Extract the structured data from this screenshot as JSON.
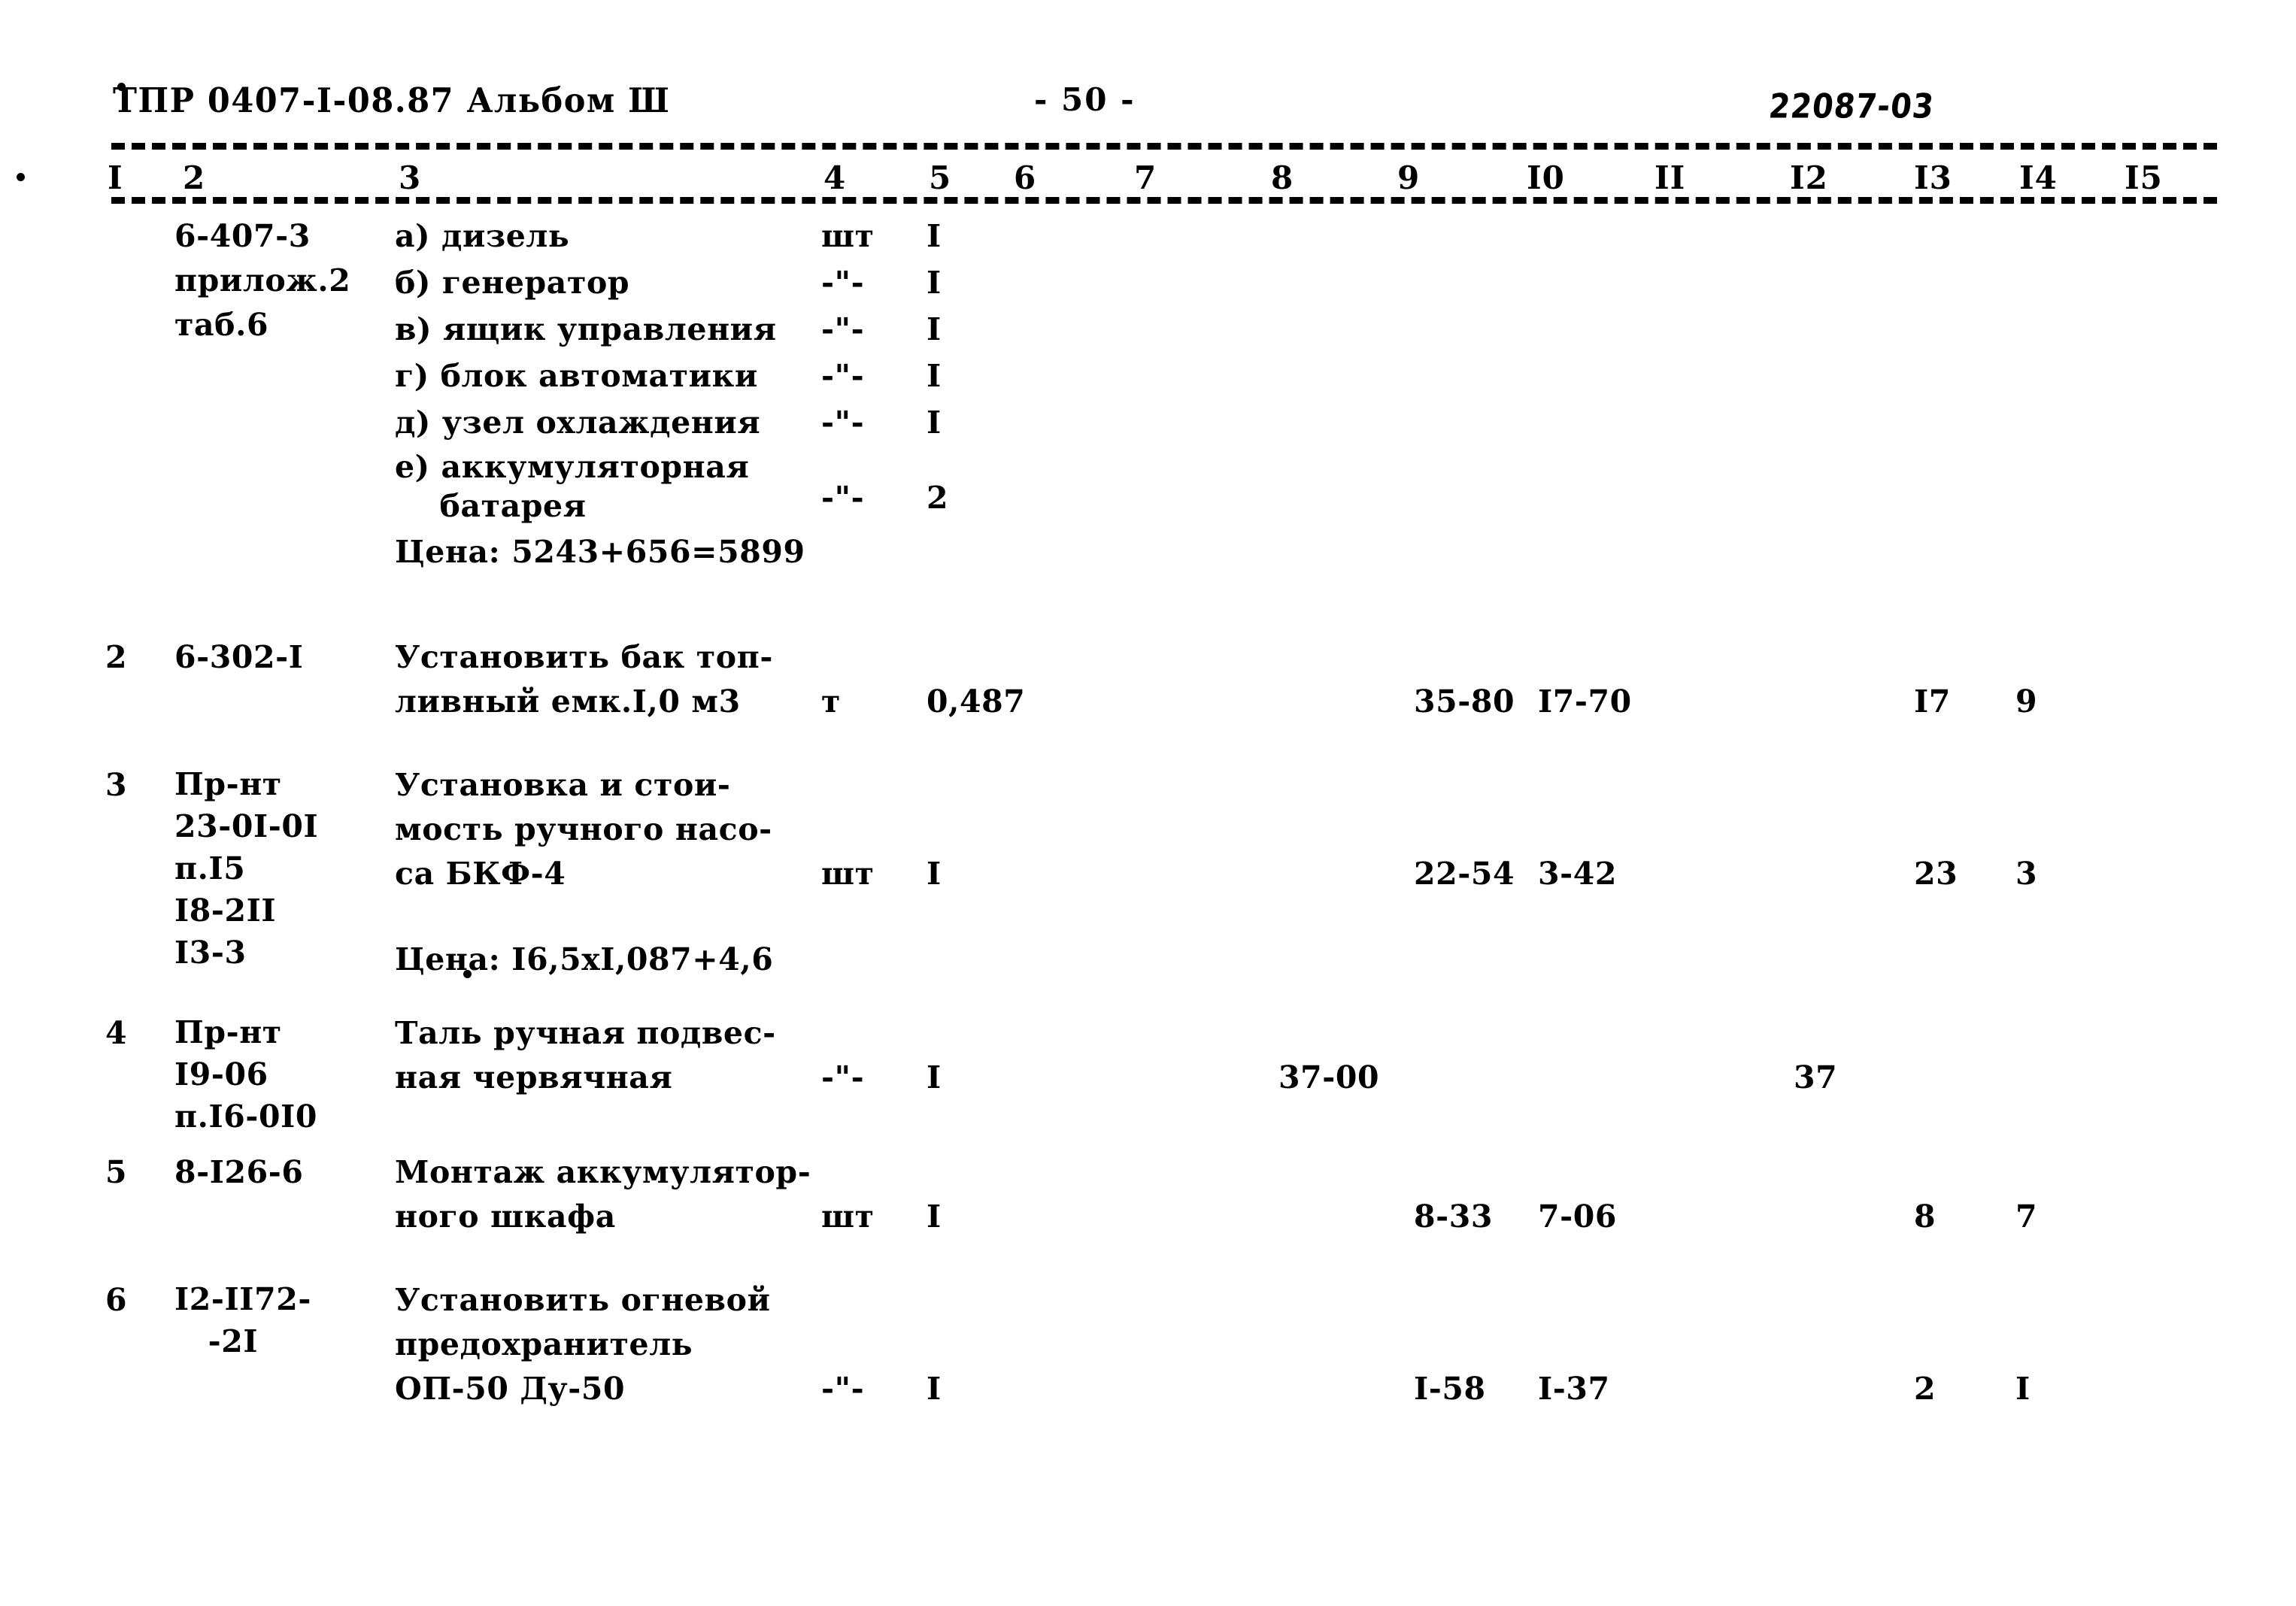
{
  "header": {
    "doc_code": "ТПР 0407-I-08.87 Альбом Ш",
    "page_number": "- 50 -",
    "stamp": "22087-03"
  },
  "table": {
    "column_headers": [
      "I",
      "2",
      "3",
      "4",
      "5",
      "6",
      "7",
      "8",
      "9",
      "I0",
      "II",
      "I2",
      "I3",
      "I4",
      "I5"
    ],
    "rows": [
      {
        "num": "",
        "code": "6-407-3\nприлож.2\nтаб.6",
        "items": [
          {
            "desc": "а) дизель",
            "unit": "шт",
            "qty": "I"
          },
          {
            "desc": "б) генератор",
            "unit": "-\"-",
            "qty": "I"
          },
          {
            "desc": "в) ящик управления",
            "unit": "-\"-",
            "qty": "I"
          },
          {
            "desc": "г) блок автоматики",
            "unit": "-\"-",
            "qty": "I"
          },
          {
            "desc": "д) узел охлаждения",
            "unit": "-\"-",
            "qty": "I"
          },
          {
            "desc": "е) аккумуляторная\n    батарея",
            "unit": "-\"-",
            "qty": "2"
          }
        ],
        "price_note": "Цена: 5243+656=5899"
      },
      {
        "num": "2",
        "code": "6-302-I",
        "desc": "Установить бак топ-\nливный емк.I,0 м3",
        "unit": "т",
        "qty": "0,487",
        "c9": "35-80",
        "c10": "I7-70",
        "c13": "I7",
        "c14": "9"
      },
      {
        "num": "3",
        "code": "Пр-нт\n23-0I-0I\nп.I5\nI8-2II\nI3-3",
        "desc": "Установка и стои-\nмость ручного насо-\nса БКФ-4",
        "unit": "шт",
        "qty": "I",
        "c9": "22-54",
        "c10": "3-42",
        "c13": "23",
        "c14": "3",
        "price_note": "Цена: I6,5xI,087+4,6"
      },
      {
        "num": "4",
        "code": "Пр-нт\nI9-06\nп.I6-0I0",
        "desc": "Таль ручная подвес-\nная червячная",
        "unit": "-\"-",
        "qty": "I",
        "c8": "37-00",
        "c12": "37"
      },
      {
        "num": "5",
        "code": "8-I26-6",
        "desc": "Монтаж аккумулятор-\nного шкафа",
        "unit": "шт",
        "qty": "I",
        "c9": "8-33",
        "c10": "7-06",
        "c13": "8",
        "c14": "7"
      },
      {
        "num": "6",
        "code": "I2-II72-\n   -2I",
        "desc": "Установить огневой\nпредохранитель\nОП-50 Ду-50",
        "unit": "-\"-",
        "qty": "I",
        "c9": "I-58",
        "c10": "I-37",
        "c13": "2",
        "c14": "I"
      }
    ]
  }
}
